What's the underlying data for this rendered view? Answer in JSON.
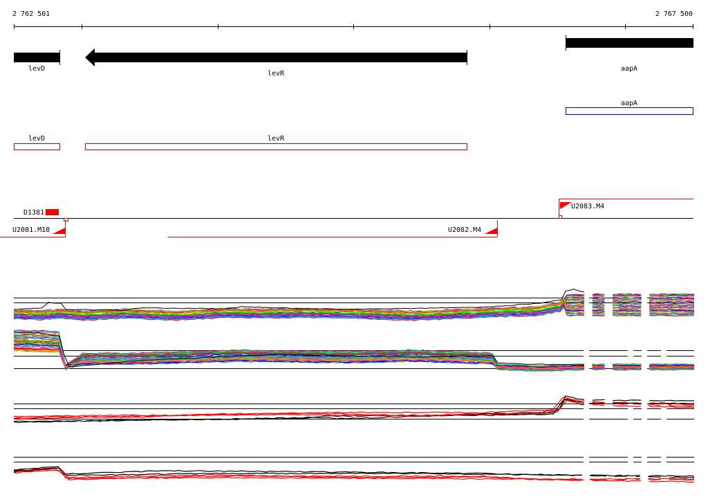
{
  "ruler": {
    "start_label": "2 762 501",
    "end_label": "2 767 500"
  },
  "genes": [
    {
      "name": "levD",
      "strand": "+"
    },
    {
      "name": "levR",
      "strand": "-"
    },
    {
      "name": "aapA",
      "strand": "+"
    }
  ],
  "annotation_boxes": [
    {
      "name": "aapA",
      "color": "#0000cc"
    },
    {
      "name": "levD",
      "color": "#cc0000"
    },
    {
      "name": "levR",
      "color": "#cc0000"
    }
  ],
  "features": {
    "upper": [
      {
        "name": "D1381"
      },
      {
        "name": "U2083.M4"
      }
    ],
    "lower": [
      {
        "name": "U2081.M18"
      },
      {
        "name": "U2082.M4"
      }
    ]
  },
  "tracks": [
    {
      "name": "expression-track-1",
      "style": "multicolor"
    },
    {
      "name": "expression-track-2",
      "style": "multicolor"
    },
    {
      "name": "expression-track-3",
      "style": "red-black"
    },
    {
      "name": "expression-track-4",
      "style": "red-black"
    }
  ],
  "colors": {
    "gene": "#000000",
    "box_red": "#cc0000",
    "box_blue": "#0000cc",
    "feature": "#ff0000",
    "palette": [
      "#ff0000",
      "#00aa00",
      "#0000ff",
      "#ff00ff",
      "#00cccc",
      "#ff8800",
      "#888800",
      "#8800ff",
      "#00ff00",
      "#ff0088",
      "#0088ff",
      "#aa5500",
      "#999999",
      "#ffcc00"
    ]
  }
}
